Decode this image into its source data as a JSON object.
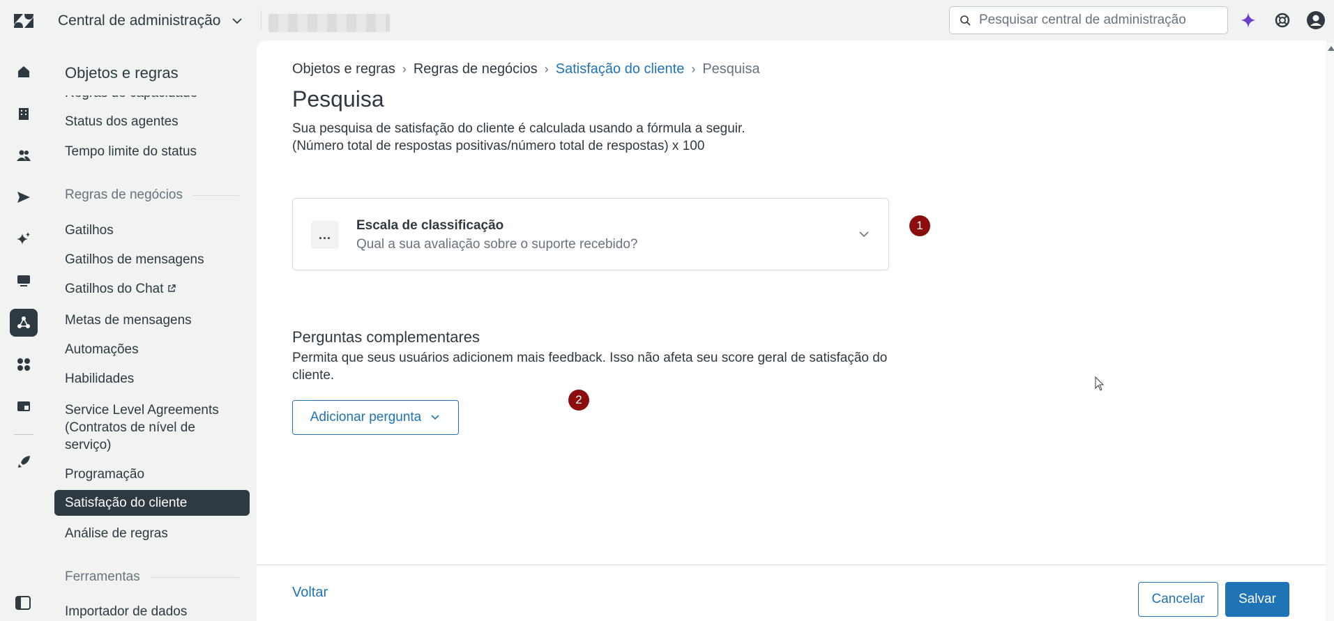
{
  "topbar": {
    "product_name": "Central de administração",
    "search_placeholder": "Pesquisar central de administração"
  },
  "sidenav": {
    "title": "Objetos e regras",
    "items": [
      {
        "label": "Regras de capacidade"
      },
      {
        "label": "Status dos agentes"
      },
      {
        "label": "Tempo limite do status"
      },
      {
        "label": "Regras de negócios"
      },
      {
        "label": "Gatilhos"
      },
      {
        "label": "Gatilhos de mensagens"
      },
      {
        "label": "Gatilhos do Chat"
      },
      {
        "label": "Metas de mensagens"
      },
      {
        "label": "Automações"
      },
      {
        "label": "Habilidades"
      },
      {
        "label": "Service Level Agreements (Contratos de nível de serviço)"
      },
      {
        "label": "Programação"
      },
      {
        "label": "Satisfação do cliente"
      },
      {
        "label": "Análise de regras"
      },
      {
        "label": "Ferramentas"
      },
      {
        "label": "Importador de dados"
      }
    ]
  },
  "breadcrumb": {
    "items": [
      "Objetos e regras",
      "Regras de negócios",
      "Satisfação do cliente",
      "Pesquisa"
    ]
  },
  "page": {
    "title": "Pesquisa",
    "description_line1": "Sua pesquisa de satisfação do cliente é calculada usando a fórmula a seguir.",
    "description_line2": "(Número total de respostas positivas/número total de respostas) x 100"
  },
  "rating_card": {
    "icon_text": "...",
    "title": "Escala de classificação",
    "subtitle": "Qual a sua avaliação sobre o suporte recebido?"
  },
  "badges": [
    "1",
    "2"
  ],
  "followup": {
    "title": "Perguntas complementares",
    "description": "Permita que seus usuários adicionem mais feedback. Isso não afeta seu score geral de satisfação do cliente.",
    "add_button": "Adicionar pergunta"
  },
  "footer": {
    "back": "Voltar",
    "cancel": "Cancelar",
    "save": "Salvar"
  },
  "colors": {
    "accent": "#1f73b7",
    "badge": "#8c0d0d",
    "ai_icon": "#6a3ec9"
  }
}
